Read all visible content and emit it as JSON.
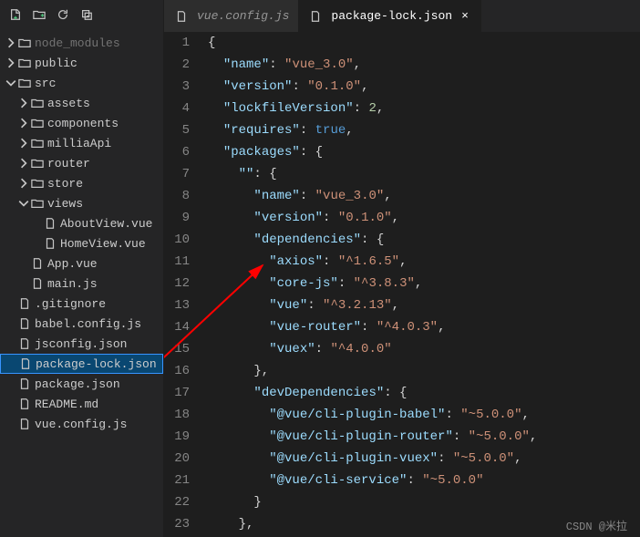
{
  "toolbar_icons": [
    "new-file",
    "new-folder",
    "refresh",
    "collapse"
  ],
  "tree": [
    {
      "indent": 0,
      "chev": "right",
      "icon": "folder",
      "label": "node_modules",
      "dim": true
    },
    {
      "indent": 0,
      "chev": "right",
      "icon": "folder",
      "label": "public"
    },
    {
      "indent": 0,
      "chev": "down",
      "icon": "folder",
      "label": "src"
    },
    {
      "indent": 1,
      "chev": "right",
      "icon": "folder",
      "label": "assets"
    },
    {
      "indent": 1,
      "chev": "right",
      "icon": "folder",
      "label": "components"
    },
    {
      "indent": 1,
      "chev": "right",
      "icon": "folder",
      "label": "milliaApi"
    },
    {
      "indent": 1,
      "chev": "right",
      "icon": "folder",
      "label": "router"
    },
    {
      "indent": 1,
      "chev": "right",
      "icon": "folder",
      "label": "store"
    },
    {
      "indent": 1,
      "chev": "down",
      "icon": "folder",
      "label": "views"
    },
    {
      "indent": 2,
      "chev": "",
      "icon": "file",
      "label": "AboutView.vue"
    },
    {
      "indent": 2,
      "chev": "",
      "icon": "file",
      "label": "HomeView.vue"
    },
    {
      "indent": 1,
      "chev": "",
      "icon": "file",
      "label": "App.vue"
    },
    {
      "indent": 1,
      "chev": "",
      "icon": "file",
      "label": "main.js"
    },
    {
      "indent": 0,
      "chev": "",
      "icon": "file",
      "label": ".gitignore"
    },
    {
      "indent": 0,
      "chev": "",
      "icon": "file",
      "label": "babel.config.js"
    },
    {
      "indent": 0,
      "chev": "",
      "icon": "file",
      "label": "jsconfig.json"
    },
    {
      "indent": 0,
      "chev": "",
      "icon": "file",
      "label": "package-lock.json",
      "selected": true
    },
    {
      "indent": 0,
      "chev": "",
      "icon": "file",
      "label": "package.json"
    },
    {
      "indent": 0,
      "chev": "",
      "icon": "file",
      "label": "README.md"
    },
    {
      "indent": 0,
      "chev": "",
      "icon": "file",
      "label": "vue.config.js"
    }
  ],
  "tabs": [
    {
      "icon": "file",
      "label": "vue.config.js",
      "active": false
    },
    {
      "icon": "file",
      "label": "package-lock.json",
      "active": true,
      "close": "×"
    }
  ],
  "code": [
    {
      "n": 1,
      "t": [
        [
          "p",
          "{"
        ]
      ]
    },
    {
      "n": 2,
      "t": [
        [
          "p",
          "  "
        ],
        [
          "k",
          "\"name\""
        ],
        [
          "p",
          ": "
        ],
        [
          "s",
          "\"vue_3.0\""
        ],
        [
          "p",
          ","
        ]
      ]
    },
    {
      "n": 3,
      "t": [
        [
          "p",
          "  "
        ],
        [
          "k",
          "\"version\""
        ],
        [
          "p",
          ": "
        ],
        [
          "s",
          "\"0.1.0\""
        ],
        [
          "p",
          ","
        ]
      ]
    },
    {
      "n": 4,
      "t": [
        [
          "p",
          "  "
        ],
        [
          "k",
          "\"lockfileVersion\""
        ],
        [
          "p",
          ": "
        ],
        [
          "n",
          "2"
        ],
        [
          "p",
          ","
        ]
      ]
    },
    {
      "n": 5,
      "t": [
        [
          "p",
          "  "
        ],
        [
          "k",
          "\"requires\""
        ],
        [
          "p",
          ": "
        ],
        [
          "kw",
          "true"
        ],
        [
          "p",
          ","
        ]
      ]
    },
    {
      "n": 6,
      "t": [
        [
          "p",
          "  "
        ],
        [
          "k",
          "\"packages\""
        ],
        [
          "p",
          ": {"
        ]
      ]
    },
    {
      "n": 7,
      "t": [
        [
          "p",
          "    "
        ],
        [
          "k",
          "\"\""
        ],
        [
          "p",
          ": {"
        ]
      ]
    },
    {
      "n": 8,
      "t": [
        [
          "p",
          "      "
        ],
        [
          "k",
          "\"name\""
        ],
        [
          "p",
          ": "
        ],
        [
          "s",
          "\"vue_3.0\""
        ],
        [
          "p",
          ","
        ]
      ]
    },
    {
      "n": 9,
      "t": [
        [
          "p",
          "      "
        ],
        [
          "k",
          "\"version\""
        ],
        [
          "p",
          ": "
        ],
        [
          "s",
          "\"0.1.0\""
        ],
        [
          "p",
          ","
        ]
      ]
    },
    {
      "n": 10,
      "t": [
        [
          "p",
          "      "
        ],
        [
          "k",
          "\"dependencies\""
        ],
        [
          "p",
          ": {"
        ]
      ]
    },
    {
      "n": 11,
      "t": [
        [
          "p",
          "        "
        ],
        [
          "k",
          "\"axios\""
        ],
        [
          "p",
          ": "
        ],
        [
          "s",
          "\"^1.6.5\""
        ],
        [
          "p",
          ","
        ]
      ]
    },
    {
      "n": 12,
      "t": [
        [
          "p",
          "        "
        ],
        [
          "k",
          "\"core-js\""
        ],
        [
          "p",
          ": "
        ],
        [
          "s",
          "\"^3.8.3\""
        ],
        [
          "p",
          ","
        ]
      ]
    },
    {
      "n": 13,
      "t": [
        [
          "p",
          "        "
        ],
        [
          "k",
          "\"vue\""
        ],
        [
          "p",
          ": "
        ],
        [
          "s",
          "\"^3.2.13\""
        ],
        [
          "p",
          ","
        ]
      ]
    },
    {
      "n": 14,
      "t": [
        [
          "p",
          "        "
        ],
        [
          "k",
          "\"vue-router\""
        ],
        [
          "p",
          ": "
        ],
        [
          "s",
          "\"^4.0.3\""
        ],
        [
          "p",
          ","
        ]
      ]
    },
    {
      "n": 15,
      "t": [
        [
          "p",
          "        "
        ],
        [
          "k",
          "\"vuex\""
        ],
        [
          "p",
          ": "
        ],
        [
          "s",
          "\"^4.0.0\""
        ]
      ]
    },
    {
      "n": 16,
      "t": [
        [
          "p",
          "      },"
        ]
      ]
    },
    {
      "n": 17,
      "t": [
        [
          "p",
          "      "
        ],
        [
          "k",
          "\"devDependencies\""
        ],
        [
          "p",
          ": {"
        ]
      ]
    },
    {
      "n": 18,
      "t": [
        [
          "p",
          "        "
        ],
        [
          "k",
          "\"@vue/cli-plugin-babel\""
        ],
        [
          "p",
          ": "
        ],
        [
          "s",
          "\"~5.0.0\""
        ],
        [
          "p",
          ","
        ]
      ]
    },
    {
      "n": 19,
      "t": [
        [
          "p",
          "        "
        ],
        [
          "k",
          "\"@vue/cli-plugin-router\""
        ],
        [
          "p",
          ": "
        ],
        [
          "s",
          "\"~5.0.0\""
        ],
        [
          "p",
          ","
        ]
      ]
    },
    {
      "n": 20,
      "t": [
        [
          "p",
          "        "
        ],
        [
          "k",
          "\"@vue/cli-plugin-vuex\""
        ],
        [
          "p",
          ": "
        ],
        [
          "s",
          "\"~5.0.0\""
        ],
        [
          "p",
          ","
        ]
      ]
    },
    {
      "n": 21,
      "t": [
        [
          "p",
          "        "
        ],
        [
          "k",
          "\"@vue/cli-service\""
        ],
        [
          "p",
          ": "
        ],
        [
          "s",
          "\"~5.0.0\""
        ]
      ]
    },
    {
      "n": 22,
      "t": [
        [
          "p",
          "      }"
        ]
      ]
    },
    {
      "n": 23,
      "t": [
        [
          "p",
          "    },"
        ]
      ]
    }
  ],
  "watermark": "CSDN @米拉"
}
